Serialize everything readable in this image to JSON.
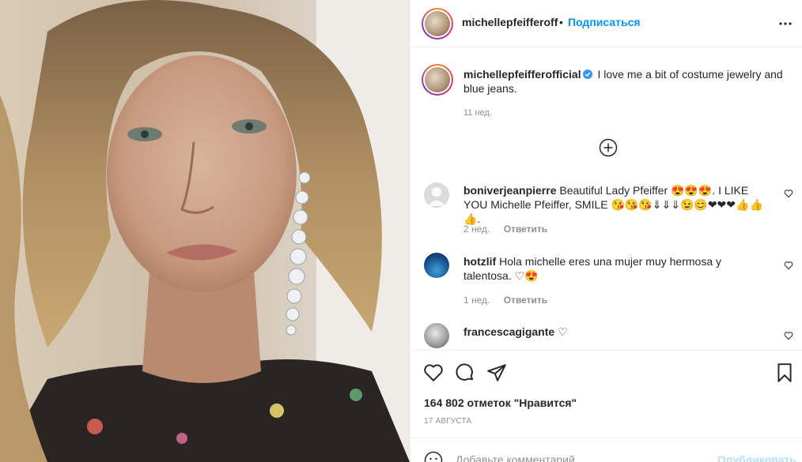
{
  "post": {
    "author": "michellepfeifferoff",
    "separator": "•",
    "follow_label": "Подписаться",
    "more_icon": "ellipsis-icon"
  },
  "caption": {
    "username": "michellepfeifferofficial",
    "text": "I love me a bit of costume jewelry and blue jeans.",
    "time": "11 нед."
  },
  "comments": [
    {
      "username": "boniverjeanpierre",
      "text": "Beautiful Lady Pfeiffer 😍😍😍. I LIKE YOU Michelle Pfeiffer, SMILE 😘😘😘⇓⇓⇓😉😊❤❤❤👍👍👍.",
      "time": "2 нед.",
      "reply_label": "Ответить"
    },
    {
      "username": "hotzlif",
      "text": "Hola michelle eres una mujer muy hermosa y talentosa. ♡😍",
      "time": "1 нед.",
      "reply_label": "Ответить"
    },
    {
      "username": "francescagigante",
      "text": "♡"
    }
  ],
  "stats": {
    "likes": "164 802 отметок \"Нравится\"",
    "date": "17 августа"
  },
  "comment_box": {
    "placeholder": "Добавьте комментарий...",
    "publish_label": "Опубликовать"
  },
  "colors": {
    "accent": "#0095f6",
    "text": "#262626",
    "muted": "#8e8e8e",
    "publish_disabled": "#b2dffc"
  }
}
